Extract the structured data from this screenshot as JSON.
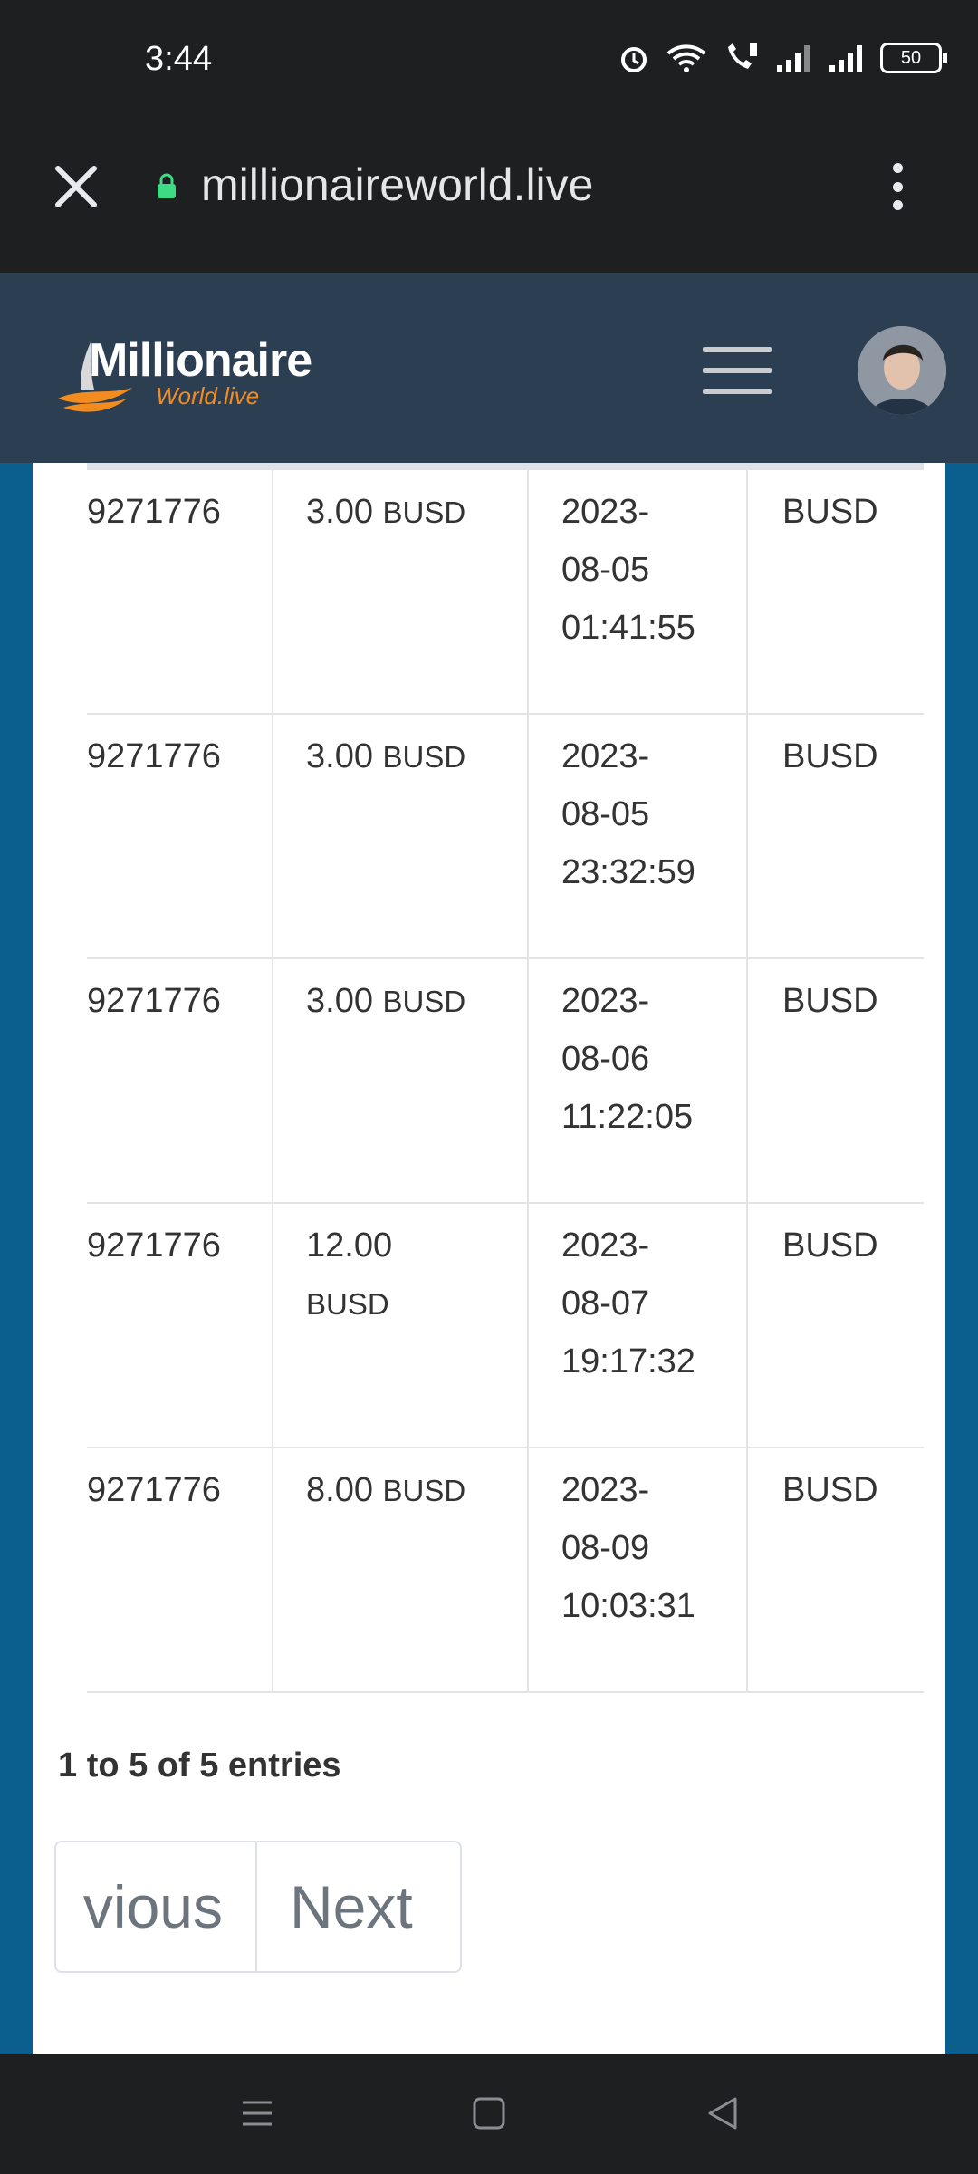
{
  "status_bar": {
    "time": "3:44",
    "battery": "50"
  },
  "browser": {
    "url": "millionaireworld.live"
  },
  "site": {
    "logo_main": "Millionaire",
    "logo_sub": "World.live"
  },
  "table": {
    "rows": [
      {
        "id": "9271776",
        "amount": "3.00",
        "amount_currency": "BUSD",
        "date_line1": "2023-",
        "date_line2": "08-05",
        "date_line3": "01:41:55",
        "currency": "BUSD"
      },
      {
        "id": "9271776",
        "amount": "3.00",
        "amount_currency": "BUSD",
        "date_line1": "2023-",
        "date_line2": "08-05",
        "date_line3": "23:32:59",
        "currency": "BUSD"
      },
      {
        "id": "9271776",
        "amount": "3.00",
        "amount_currency": "BUSD",
        "date_line1": "2023-",
        "date_line2": "08-06",
        "date_line3": "11:22:05",
        "currency": "BUSD"
      },
      {
        "id": "9271776",
        "amount": "12.00",
        "amount_currency": "BUSD",
        "date_line1": "2023-",
        "date_line2": "08-07",
        "date_line3": "19:17:32",
        "currency": "BUSD"
      },
      {
        "id": "9271776",
        "amount": "8.00",
        "amount_currency": "BUSD",
        "date_line1": "2023-",
        "date_line2": "08-09",
        "date_line3": "10:03:31",
        "currency": "BUSD"
      }
    ]
  },
  "table_info": "1 to 5 of 5 entries",
  "pagination": {
    "previous": "vious",
    "next": "Next"
  }
}
